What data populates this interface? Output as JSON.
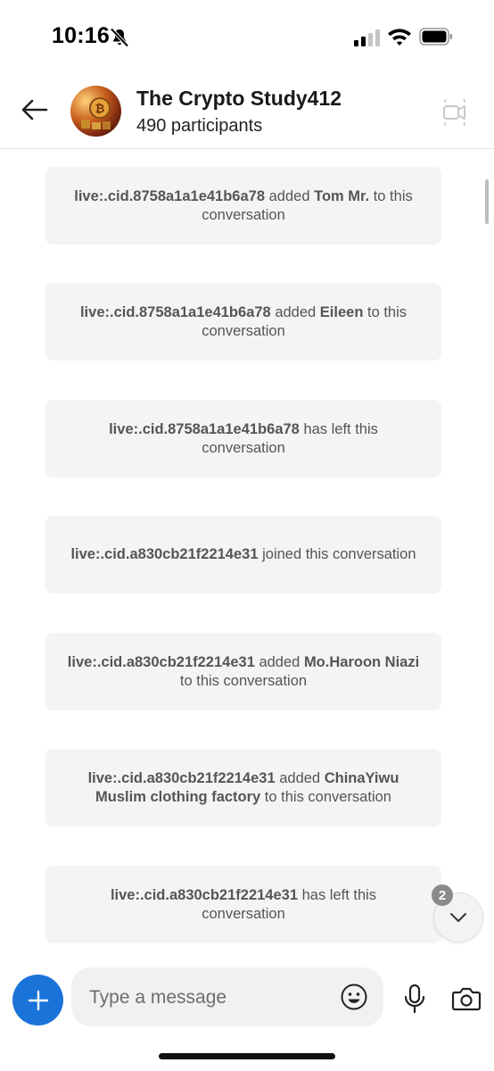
{
  "status_bar": {
    "time": "10:16"
  },
  "header": {
    "title": "The Crypto Study412",
    "subtitle": "490 participants"
  },
  "messages": [
    {
      "parts": [
        {
          "t": "live:.cid.8758a1a1e41b6a78",
          "b": true
        },
        {
          "t": " added ",
          "b": false
        },
        {
          "t": "Tom Mr.",
          "b": true
        },
        {
          "t": " to this conversation",
          "b": false
        }
      ]
    },
    {
      "parts": [
        {
          "t": "live:.cid.8758a1a1e41b6a78",
          "b": true
        },
        {
          "t": " added ",
          "b": false
        },
        {
          "t": "Eileen",
          "b": true
        },
        {
          "t": " to this conversation",
          "b": false
        }
      ]
    },
    {
      "parts": [
        {
          "t": "live:.cid.8758a1a1e41b6a78",
          "b": true
        },
        {
          "t": " has left this conversation",
          "b": false
        }
      ]
    },
    {
      "parts": [
        {
          "t": "live:.cid.a830cb21f2214e31",
          "b": true
        },
        {
          "t": " joined this conversation",
          "b": false
        }
      ]
    },
    {
      "parts": [
        {
          "t": "live:.cid.a830cb21f2214e31",
          "b": true
        },
        {
          "t": " added ",
          "b": false
        },
        {
          "t": "Mo.Haroon Niazi",
          "b": true
        },
        {
          "t": " to this conversation",
          "b": false
        }
      ]
    },
    {
      "parts": [
        {
          "t": "live:.cid.a830cb21f2214e31",
          "b": true
        },
        {
          "t": " added ",
          "b": false
        },
        {
          "t": "ChinaYiwu Muslim clothing factory",
          "b": true
        },
        {
          "t": " to this conversation",
          "b": false
        }
      ]
    },
    {
      "parts": [
        {
          "t": "live:.cid.a830cb21f2214e31",
          "b": true
        },
        {
          "t": " has left this conversation",
          "b": false
        }
      ]
    }
  ],
  "scroll_down": {
    "unread_count": "2"
  },
  "composer": {
    "placeholder": "Type a message"
  },
  "colors": {
    "accent": "#1a73d8",
    "bubble": "#f4f4f4"
  },
  "icons": [
    "bell-slash-icon",
    "signal-icon",
    "wifi-icon",
    "battery-icon",
    "back-arrow-icon",
    "video-call-icon",
    "chevron-down-icon",
    "plus-icon",
    "emoji-icon",
    "microphone-icon",
    "camera-icon"
  ]
}
